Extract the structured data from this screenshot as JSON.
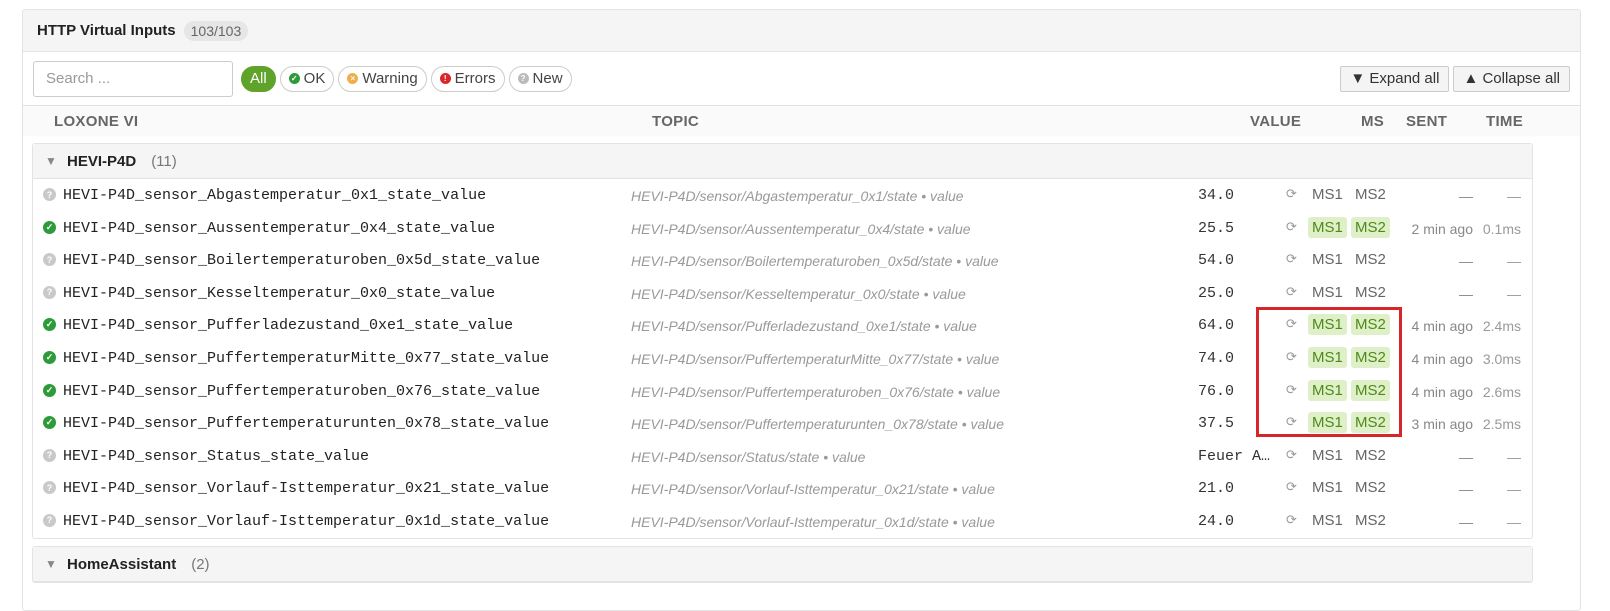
{
  "panel": {
    "title": "HTTP Virtual Inputs",
    "count": "103/103"
  },
  "search": {
    "placeholder": "Search ...",
    "value": ""
  },
  "filters": [
    {
      "label": "All",
      "active": true
    },
    {
      "label": "OK",
      "icon": "check-circle-icon",
      "color": "#2e9b3a"
    },
    {
      "label": "Warning",
      "icon": "warning-circle-icon",
      "color": "#f0ad4e"
    },
    {
      "label": "Errors",
      "icon": "error-lock-icon",
      "color": "#d9262a"
    },
    {
      "label": "New",
      "icon": "question-circle-icon",
      "color": "#bbbbbb"
    }
  ],
  "buttons": {
    "expand_all": "▼ Expand all",
    "collapse_all": "▲ Collapse all"
  },
  "columns": {
    "vi": "LOXONE VI",
    "topic": "TOPIC",
    "value": "VALUE",
    "ms": "MS",
    "sent": "SENT",
    "time": "TIME"
  },
  "groups": [
    {
      "name": "HEVI-P4D",
      "count": "(11)",
      "rows": [
        {
          "status": "new",
          "vi": "HEVI-P4D_sensor_Abgastemperatur_0x1_state_value",
          "topic": "HEVI-P4D/sensor/Abgastemperatur_0x1/state • value",
          "value": "34.0",
          "ms1": "MS1",
          "ms2": "MS2",
          "ms1_on": false,
          "ms2_on": false,
          "sent": "—",
          "time": "—"
        },
        {
          "status": "ok",
          "vi": "HEVI-P4D_sensor_Aussentemperatur_0x4_state_value",
          "topic": "HEVI-P4D/sensor/Aussentemperatur_0x4/state • value",
          "value": "25.5",
          "ms1": "MS1",
          "ms2": "MS2",
          "ms1_on": true,
          "ms2_on": true,
          "sent": "2 min ago",
          "time": "0.1ms"
        },
        {
          "status": "new",
          "vi": "HEVI-P4D_sensor_Boilertemperaturoben_0x5d_state_value",
          "topic": "HEVI-P4D/sensor/Boilertemperaturoben_0x5d/state • value",
          "value": "54.0",
          "ms1": "MS1",
          "ms2": "MS2",
          "ms1_on": false,
          "ms2_on": false,
          "sent": "—",
          "time": "—"
        },
        {
          "status": "new",
          "vi": "HEVI-P4D_sensor_Kesseltemperatur_0x0_state_value",
          "topic": "HEVI-P4D/sensor/Kesseltemperatur_0x0/state • value",
          "value": "25.0",
          "ms1": "MS1",
          "ms2": "MS2",
          "ms1_on": false,
          "ms2_on": false,
          "sent": "—",
          "time": "—"
        },
        {
          "status": "ok",
          "vi": "HEVI-P4D_sensor_Pufferladezustand_0xe1_state_value",
          "topic": "HEVI-P4D/sensor/Pufferladezustand_0xe1/state • value",
          "value": "64.0",
          "ms1": "MS1",
          "ms2": "MS2",
          "ms1_on": true,
          "ms2_on": true,
          "sent": "4 min ago",
          "time": "2.4ms"
        },
        {
          "status": "ok",
          "vi": "HEVI-P4D_sensor_PuffertemperaturMitte_0x77_state_value",
          "topic": "HEVI-P4D/sensor/PuffertemperaturMitte_0x77/state • value",
          "value": "74.0",
          "ms1": "MS1",
          "ms2": "MS2",
          "ms1_on": true,
          "ms2_on": true,
          "sent": "4 min ago",
          "time": "3.0ms"
        },
        {
          "status": "ok",
          "vi": "HEVI-P4D_sensor_Puffertemperaturoben_0x76_state_value",
          "topic": "HEVI-P4D/sensor/Puffertemperaturoben_0x76/state • value",
          "value": "76.0",
          "ms1": "MS1",
          "ms2": "MS2",
          "ms1_on": true,
          "ms2_on": true,
          "sent": "4 min ago",
          "time": "2.6ms"
        },
        {
          "status": "ok",
          "vi": "HEVI-P4D_sensor_Puffertemperaturunten_0x78_state_value",
          "topic": "HEVI-P4D/sensor/Puffertemperaturunten_0x78/state • value",
          "value": "37.5",
          "ms1": "MS1",
          "ms2": "MS2",
          "ms1_on": true,
          "ms2_on": true,
          "sent": "3 min ago",
          "time": "2.5ms"
        },
        {
          "status": "new",
          "vi": "HEVI-P4D_sensor_Status_state_value",
          "topic": "HEVI-P4D/sensor/Status/state • value",
          "value": "Feuer A…",
          "ms1": "MS1",
          "ms2": "MS2",
          "ms1_on": false,
          "ms2_on": false,
          "sent": "—",
          "time": "—"
        },
        {
          "status": "new",
          "vi": "HEVI-P4D_sensor_Vorlauf-Isttemperatur_0x21_state_value",
          "topic": "HEVI-P4D/sensor/Vorlauf-Isttemperatur_0x21/state • value",
          "value": "21.0",
          "ms1": "MS1",
          "ms2": "MS2",
          "ms1_on": false,
          "ms2_on": false,
          "sent": "—",
          "time": "—"
        },
        {
          "status": "new",
          "vi": "HEVI-P4D_sensor_Vorlauf-Isttemperatur_0x1d_state_value",
          "topic": "HEVI-P4D/sensor/Vorlauf-Isttemperatur_0x1d/state • value",
          "value": "24.0",
          "ms1": "MS1",
          "ms2": "MS2",
          "ms1_on": false,
          "ms2_on": false,
          "sent": "—",
          "time": "—"
        }
      ]
    },
    {
      "name": "HomeAssistant",
      "count": "(2)",
      "rows": []
    }
  ],
  "colors": {
    "accent": "#5fa32b",
    "ok": "#2e9b3a",
    "highlight": "#d6262a",
    "ms_on_bg": "#dff0c8",
    "ms_on_text": "#4d8a18"
  }
}
